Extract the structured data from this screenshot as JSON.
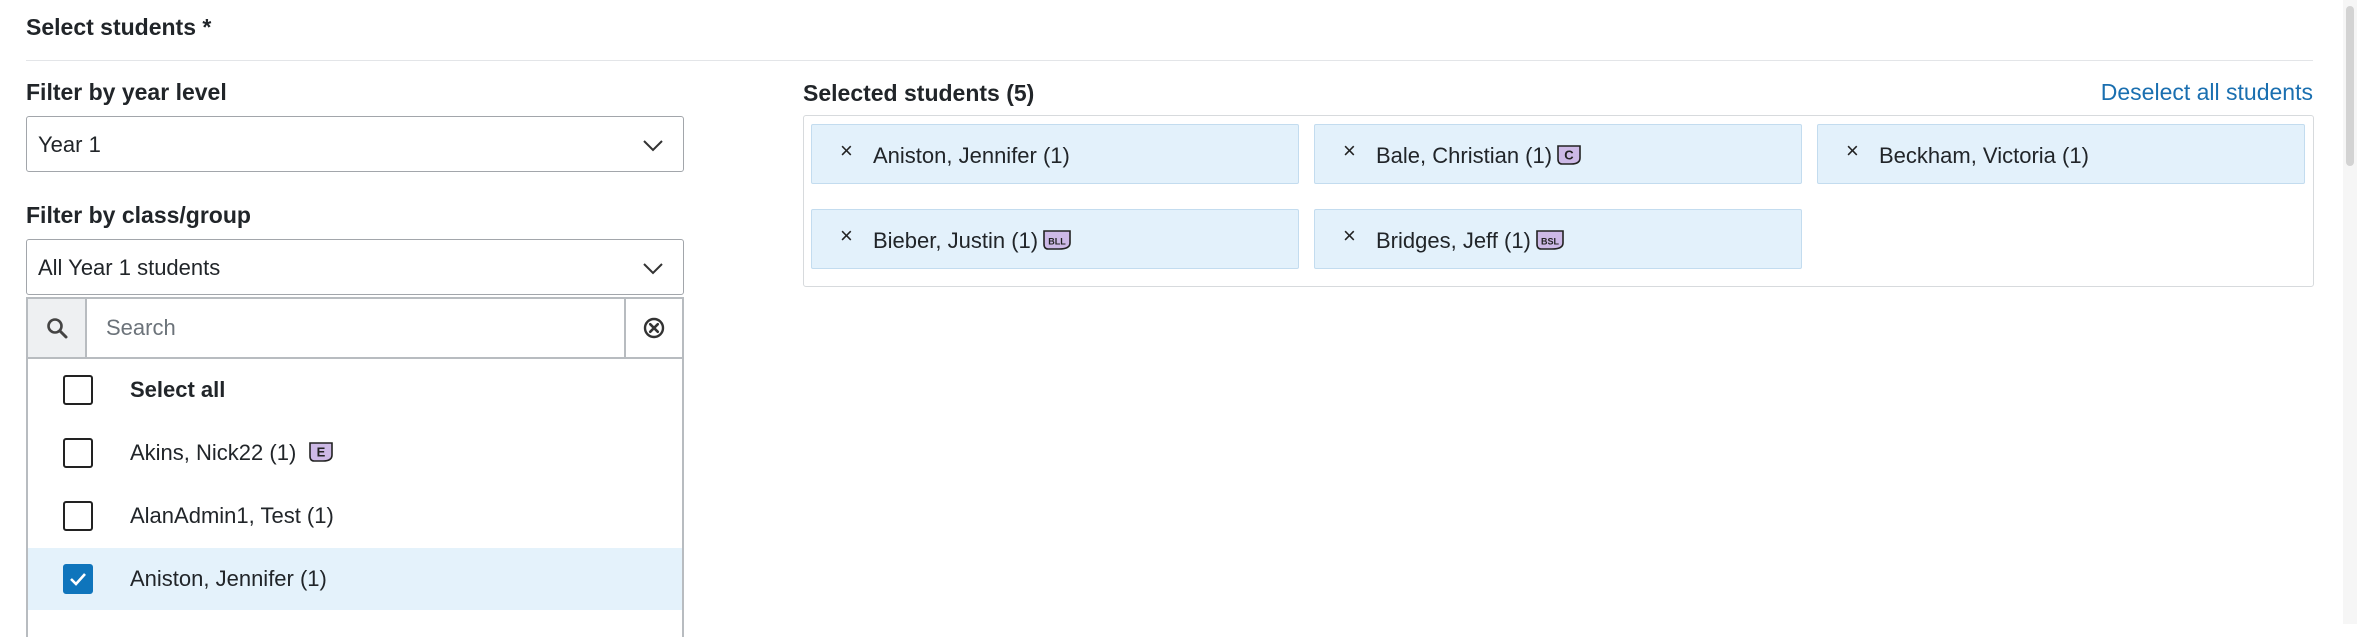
{
  "section_title": "Select students *",
  "year_filter": {
    "label": "Filter by year level",
    "value": "Year 1"
  },
  "class_filter": {
    "label": "Filter by class/group",
    "value": "All Year 1 students"
  },
  "search": {
    "placeholder": "Search",
    "value": ""
  },
  "options": [
    {
      "label": "Select all",
      "checked": false,
      "bold": true,
      "badge": null
    },
    {
      "label": "Akins, Nick22 (1)",
      "checked": false,
      "bold": false,
      "badge": "E"
    },
    {
      "label": "AlanAdmin1, Test (1)",
      "checked": false,
      "bold": false,
      "badge": null
    },
    {
      "label": "Aniston, Jennifer (1)",
      "checked": true,
      "bold": false,
      "badge": null
    }
  ],
  "selected": {
    "title": "Selected students (5)",
    "deselect_label": "Deselect all students",
    "students": [
      {
        "name": "Aniston, Jennifer (1)",
        "badge": null
      },
      {
        "name": "Bale, Christian (1)",
        "badge": "C"
      },
      {
        "name": "Beckham, Victoria (1)",
        "badge": null
      },
      {
        "name": "Bieber, Justin (1)",
        "badge": "BLL"
      },
      {
        "name": "Bridges, Jeff (1)",
        "badge": "BSL"
      }
    ]
  },
  "colors": {
    "accent": "#0f75bc",
    "link": "#1a6fb0",
    "chip_bg": "#e3f1fb",
    "badge_fill": "#cdb9e6"
  }
}
